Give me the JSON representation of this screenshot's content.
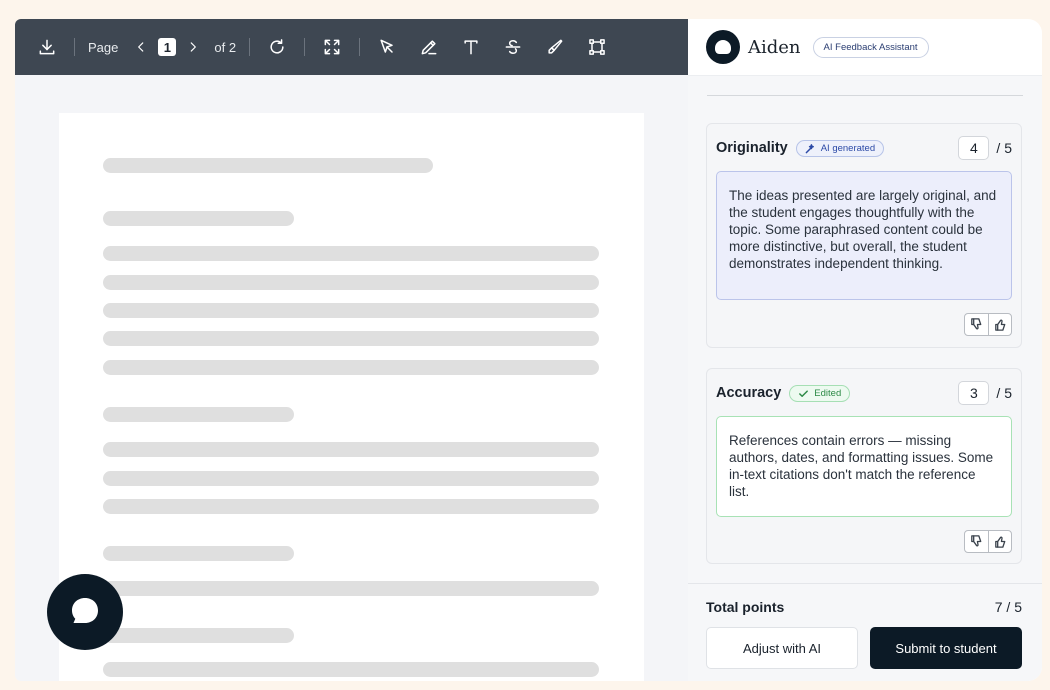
{
  "toolbar": {
    "page_label": "Page",
    "page_current": "1",
    "page_total_label": "of 2",
    "icons": [
      "download-icon",
      "chevron-left-icon",
      "chevron-right-icon",
      "rotate-icon",
      "fullscreen-icon",
      "select-pointer-icon",
      "pen-icon",
      "text-tool-icon",
      "strikethrough-icon",
      "highlighter-icon",
      "shape-icon"
    ]
  },
  "assistant": {
    "name": "Aiden",
    "subtitle": "AI Feedback Assistant"
  },
  "criteria": [
    {
      "title": "Originality",
      "tag": "AI generated",
      "score": "4",
      "max": "/ 5",
      "feedback": "The ideas presented are largely original, and the student engages thoughtfully with the topic. Some paraphrased content could be more distinctive, but overall, the student demonstrates independent thinking."
    },
    {
      "title": "Accuracy",
      "tag": "Edited",
      "score": "3",
      "max": "/ 5",
      "feedback": "References contain errors — missing authors, dates, and formatting issues. Some in-text citations don't match the reference list."
    }
  ],
  "footer": {
    "total_label": "Total points",
    "total_value": "7 / 5",
    "adjust_label": "Adjust with AI",
    "submit_label": "Submit to student"
  },
  "colors": {
    "toolbar": "#3e4752",
    "primary": "#0c1a26",
    "ai_tag": "#2c4aa6",
    "edited_tag": "#2c8a46"
  }
}
